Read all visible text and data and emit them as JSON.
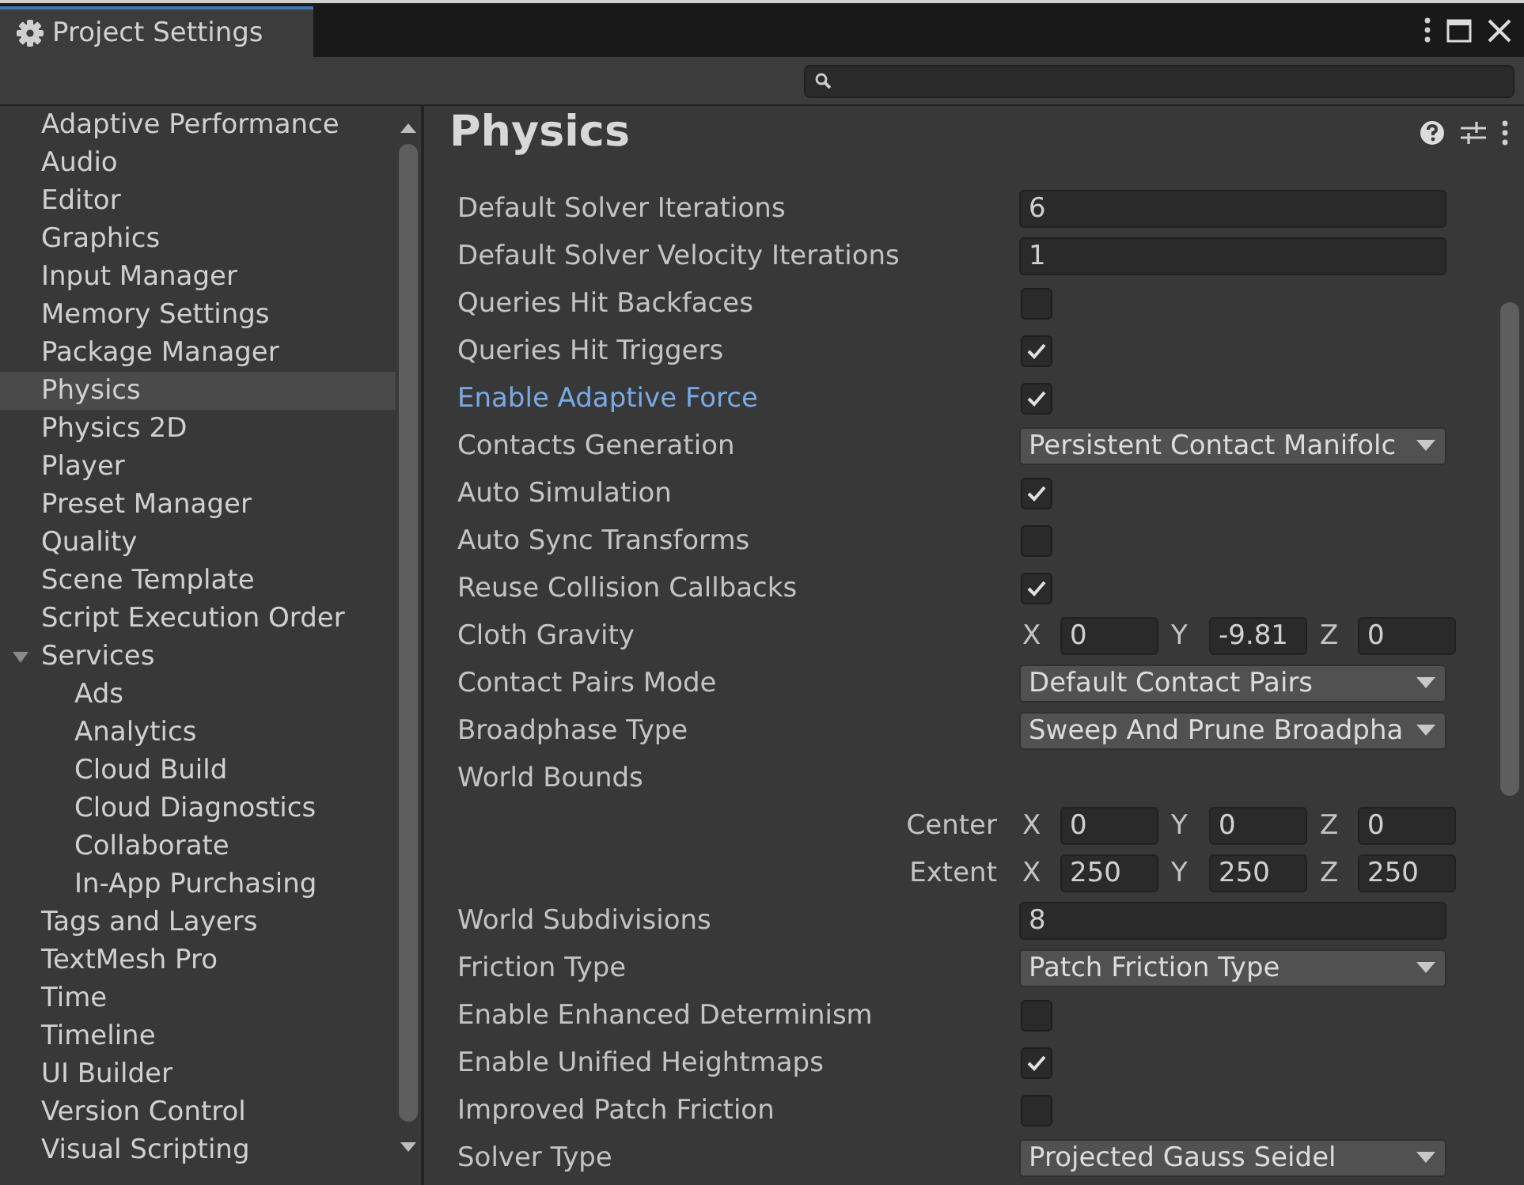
{
  "window": {
    "title": "Project Settings"
  },
  "sidebar": {
    "items": [
      {
        "label": "Adaptive Performance",
        "selected": false
      },
      {
        "label": "Audio",
        "selected": false
      },
      {
        "label": "Editor",
        "selected": false
      },
      {
        "label": "Graphics",
        "selected": false
      },
      {
        "label": "Input Manager",
        "selected": false
      },
      {
        "label": "Memory Settings",
        "selected": false
      },
      {
        "label": "Package Manager",
        "selected": false
      },
      {
        "label": "Physics",
        "selected": true
      },
      {
        "label": "Physics 2D",
        "selected": false
      },
      {
        "label": "Player",
        "selected": false
      },
      {
        "label": "Preset Manager",
        "selected": false
      },
      {
        "label": "Quality",
        "selected": false
      },
      {
        "label": "Scene Template",
        "selected": false
      },
      {
        "label": "Script Execution Order",
        "selected": false
      },
      {
        "label": "Services",
        "selected": false,
        "expanded": true,
        "children": [
          {
            "label": "Ads",
            "selected": false
          },
          {
            "label": "Analytics",
            "selected": false
          },
          {
            "label": "Cloud Build",
            "selected": false
          },
          {
            "label": "Cloud Diagnostics",
            "selected": false
          },
          {
            "label": "Collaborate",
            "selected": false
          },
          {
            "label": "In-App Purchasing",
            "selected": false
          }
        ]
      },
      {
        "label": "Tags and Layers",
        "selected": false
      },
      {
        "label": "TextMesh Pro",
        "selected": false
      },
      {
        "label": "Time",
        "selected": false
      },
      {
        "label": "Timeline",
        "selected": false
      },
      {
        "label": "UI Builder",
        "selected": false
      },
      {
        "label": "Version Control",
        "selected": false
      },
      {
        "label": "Visual Scripting",
        "selected": false
      }
    ]
  },
  "panel": {
    "title": "Physics",
    "rows": [
      {
        "kind": "number",
        "label": "Default Solver Iterations",
        "value": "6",
        "highlighted": false
      },
      {
        "kind": "number",
        "label": "Default Solver Velocity Iterations",
        "value": "1",
        "highlighted": false
      },
      {
        "kind": "checkbox",
        "label": "Queries Hit Backfaces",
        "checked": false,
        "highlighted": false
      },
      {
        "kind": "checkbox",
        "label": "Queries Hit Triggers",
        "checked": true,
        "highlighted": false
      },
      {
        "kind": "checkbox",
        "label": "Enable Adaptive Force",
        "checked": true,
        "highlighted": true
      },
      {
        "kind": "dropdown",
        "label": "Contacts Generation",
        "value": "Persistent Contact Manifolc",
        "highlighted": false
      },
      {
        "kind": "checkbox",
        "label": "Auto Simulation",
        "checked": true,
        "highlighted": false
      },
      {
        "kind": "checkbox",
        "label": "Auto Sync Transforms",
        "checked": false,
        "highlighted": false
      },
      {
        "kind": "checkbox",
        "label": "Reuse Collision Callbacks",
        "checked": true,
        "highlighted": false
      },
      {
        "kind": "vector3",
        "label": "Cloth Gravity",
        "fields": [
          {
            "axis": "X",
            "value": "0"
          },
          {
            "axis": "Y",
            "value": "-9.81"
          },
          {
            "axis": "Z",
            "value": "0"
          }
        ],
        "highlighted": false
      },
      {
        "kind": "dropdown",
        "label": "Contact Pairs Mode",
        "value": "Default Contact Pairs",
        "highlighted": false
      },
      {
        "kind": "dropdown",
        "label": "Broadphase Type",
        "value": "Sweep And Prune Broadpha",
        "highlighted": false
      },
      {
        "kind": "header",
        "label": "World Bounds",
        "highlighted": false
      },
      {
        "kind": "vector3",
        "sublabel": "Center",
        "fields": [
          {
            "axis": "X",
            "value": "0"
          },
          {
            "axis": "Y",
            "value": "0"
          },
          {
            "axis": "Z",
            "value": "0"
          }
        ]
      },
      {
        "kind": "vector3",
        "sublabel": "Extent",
        "fields": [
          {
            "axis": "X",
            "value": "250"
          },
          {
            "axis": "Y",
            "value": "250"
          },
          {
            "axis": "Z",
            "value": "250"
          }
        ]
      },
      {
        "kind": "number",
        "label": "World Subdivisions",
        "value": "8",
        "highlighted": false
      },
      {
        "kind": "dropdown",
        "label": "Friction Type",
        "value": "Patch Friction Type",
        "highlighted": false
      },
      {
        "kind": "checkbox",
        "label": "Enable Enhanced Determinism",
        "checked": false,
        "highlighted": false
      },
      {
        "kind": "checkbox",
        "label": "Enable Unified Heightmaps",
        "checked": true,
        "highlighted": false
      },
      {
        "kind": "checkbox",
        "label": "Improved Patch Friction",
        "checked": false,
        "highlighted": false
      },
      {
        "kind": "dropdown",
        "label": "Solver Type",
        "value": "Projected Gauss Seidel",
        "highlighted": false
      }
    ]
  }
}
